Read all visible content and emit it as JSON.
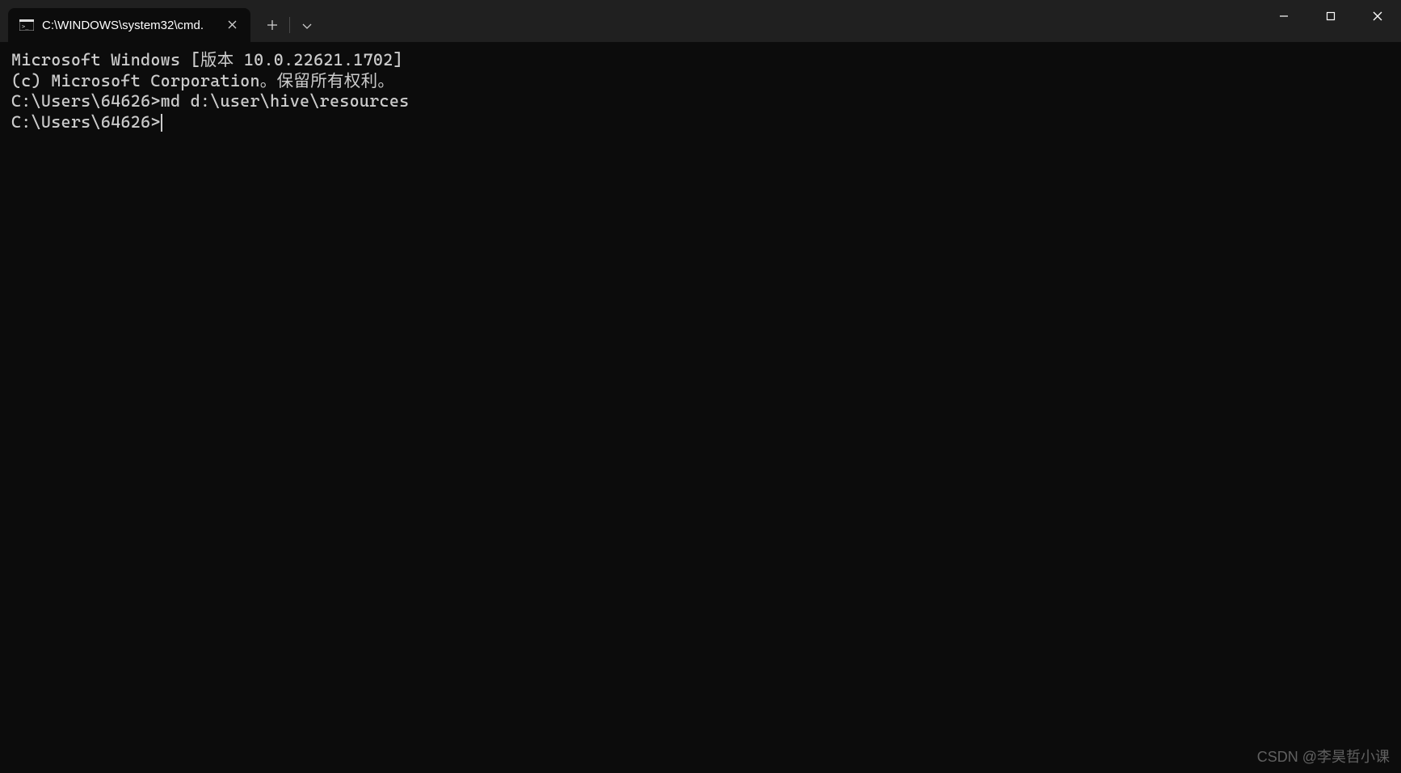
{
  "titlebar": {
    "tab_title": "C:\\WINDOWS\\system32\\cmd."
  },
  "terminal": {
    "line1": "Microsoft Windows [版本 10.0.22621.1702]",
    "line2": "(c) Microsoft Corporation。保留所有权利。",
    "line3": "",
    "line4": "C:\\Users\\64626>md d:\\user\\hive\\resources",
    "line5": "",
    "prompt": "C:\\Users\\64626>"
  },
  "watermark": "CSDN @李昊哲小课"
}
